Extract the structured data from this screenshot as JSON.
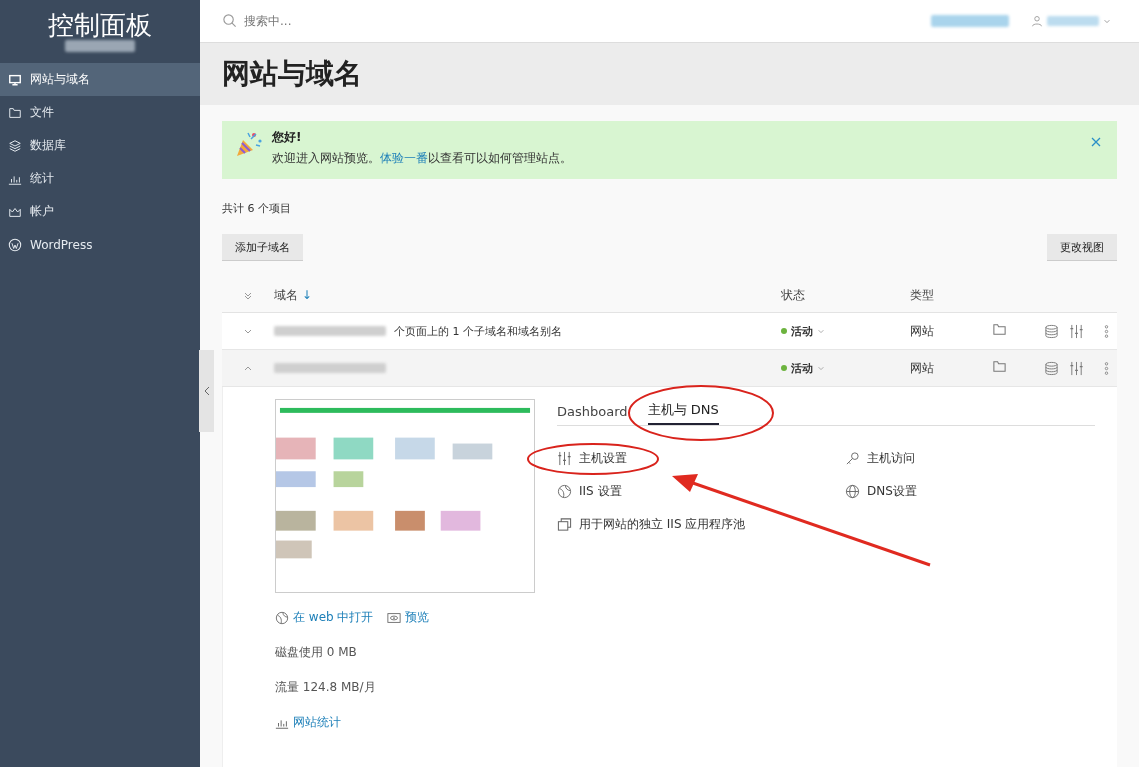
{
  "sidebar": {
    "title": "控制面板",
    "items": [
      {
        "label": "网站与域名",
        "selected": true
      },
      {
        "label": "文件",
        "selected": false
      },
      {
        "label": "数据库",
        "selected": false
      },
      {
        "label": "统计",
        "selected": false
      },
      {
        "label": "帐户",
        "selected": false
      },
      {
        "label": "WordPress",
        "selected": false
      }
    ]
  },
  "search": {
    "placeholder": "搜索中..."
  },
  "page_title": "网站与域名",
  "banner": {
    "title": "您好!",
    "text_before": "欢迎进入网站预览。",
    "link": "体验一番",
    "text_after": "以查看可以如何管理站点。"
  },
  "item_count": "共计 6 个项目",
  "buttons": {
    "add": "添加子域名",
    "view": "更改视图"
  },
  "table": {
    "columns": [
      "域名",
      "状态",
      "类型"
    ],
    "sort_mark": "↓",
    "rows": [
      {
        "name": "个页面上的 1 个子域名和域名别名",
        "status": "活动",
        "type": "网站",
        "expanded": false
      },
      {
        "name": "",
        "status": "活动",
        "type": "网站",
        "expanded": true
      }
    ]
  },
  "details": {
    "tabs": [
      {
        "label": "Dashboard",
        "selected": false
      },
      {
        "label": "主机与 DNS",
        "selected": true
      }
    ],
    "actions": [
      {
        "label": "主机设置"
      },
      {
        "label": "主机访问"
      },
      {
        "label": "IIS 设置"
      },
      {
        "label": "DNS设置"
      },
      {
        "label": "用于网站的独立 IIS 应用程序池"
      }
    ],
    "open_link": "在 web 中打开",
    "preview_link": "预览",
    "disk": "磁盘使用 0 MB",
    "traffic": "流量 124.8 MB/月",
    "stats_link": "网站统计"
  }
}
